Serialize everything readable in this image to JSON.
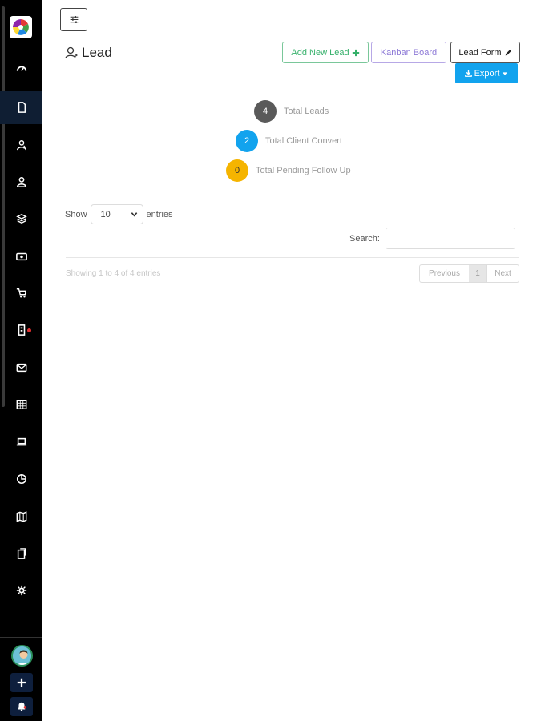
{
  "header": {
    "title": "Lead",
    "buttons": {
      "add_new_lead": "Add New Lead",
      "kanban_board": "Kanban Board",
      "lead_form": "Lead Form",
      "export": "Export"
    }
  },
  "stats": [
    {
      "value": "4",
      "label": "Total Leads",
      "color": "#5a5a5a"
    },
    {
      "value": "2",
      "label": "Total Client Convert",
      "color": "#12a3ee"
    },
    {
      "value": "0",
      "label": "Total Pending Follow Up",
      "color": "#f5b400"
    }
  ],
  "table_controls": {
    "show_label": "Show",
    "entries_value": "10",
    "entries_label": "entries",
    "search_label": "Search:",
    "info": "Showing 1 to 4 of 4 entries",
    "pager": {
      "previous": "Previous",
      "current": "1",
      "next": "Next"
    }
  },
  "sidebar": {
    "active_item": "document",
    "items": [
      "dashboard-icon",
      "document-icon",
      "user-switch-icon",
      "user-icon",
      "layers-icon",
      "money-icon",
      "cart-icon",
      "building-icon",
      "mail-icon",
      "calendar-icon",
      "laptop-icon",
      "pie-chart-icon",
      "map-icon",
      "clipboard-icon",
      "settings-icon"
    ]
  },
  "colors": {
    "sidebar_bg": "#000000",
    "active_bg": "#0f1e33",
    "accent": "#12a3ee",
    "success": "#35b06a",
    "purple": "#8c78d6",
    "warning": "#f5b400"
  }
}
